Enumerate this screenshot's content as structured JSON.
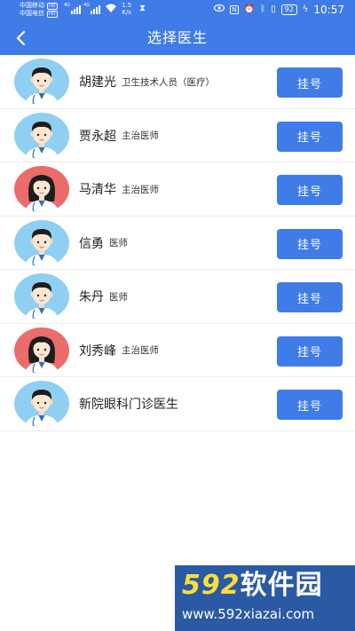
{
  "status_bar": {
    "carrier_1": "中国移动",
    "carrier_1_badge": "HD",
    "carrier_2": "中国电信",
    "carrier_2_badge": "HD",
    "network_1": "4G",
    "network_2": "4G",
    "speed_value": "1.5",
    "speed_unit": "K/s",
    "nfc_icon": "N",
    "battery": "92",
    "time": "10:57"
  },
  "header": {
    "title": "选择医生"
  },
  "doctors": [
    {
      "name": "胡建光",
      "title": "卫生技术人员（医疗）",
      "button": "挂号",
      "avatar_gender": "male"
    },
    {
      "name": "贾永超",
      "title": "主治医师",
      "button": "挂号",
      "avatar_gender": "male"
    },
    {
      "name": "马清华",
      "title": "主治医师",
      "button": "挂号",
      "avatar_gender": "female"
    },
    {
      "name": "信勇",
      "title": "医师",
      "button": "挂号",
      "avatar_gender": "male"
    },
    {
      "name": "朱丹",
      "title": "医师",
      "button": "挂号",
      "avatar_gender": "male"
    },
    {
      "name": "刘秀峰",
      "title": "主治医师",
      "button": "挂号",
      "avatar_gender": "female"
    },
    {
      "name": "新院眼科门诊医生",
      "title": "",
      "button": "挂号",
      "avatar_gender": "male"
    }
  ],
  "watermark": {
    "number": "592",
    "text": "软件园",
    "url": "www.592xiazai.com"
  },
  "colors": {
    "primary": "#3f7ce8",
    "male_avatar_bg": "#8fd0f2",
    "female_avatar_bg": "#ec6b6b"
  }
}
